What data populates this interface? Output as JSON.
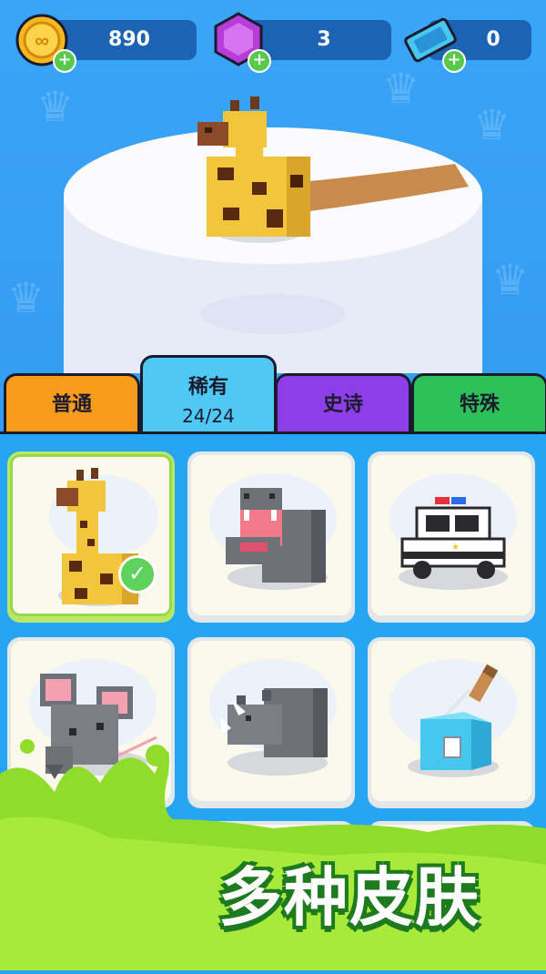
{
  "currency": {
    "coins": {
      "value": "890",
      "icon": "coin-icon"
    },
    "gems": {
      "value": "3",
      "icon": "gem-icon"
    },
    "tickets": {
      "value": "0",
      "icon": "ticket-icon"
    }
  },
  "tabs": [
    {
      "label": "普通",
      "color": "#f89a1c"
    },
    {
      "label": "稀有",
      "count": "24/24",
      "color": "#4fc8f6",
      "active": true
    },
    {
      "label": "史诗",
      "color": "#8d3ee8"
    },
    {
      "label": "特殊",
      "color": "#2ec15a"
    }
  ],
  "skins": [
    {
      "name": "giraffe",
      "selected": true
    },
    {
      "name": "hippo"
    },
    {
      "name": "police-car"
    },
    {
      "name": "mouse"
    },
    {
      "name": "rhino"
    },
    {
      "name": "ice-cube-pop"
    }
  ],
  "promo_text": "多种皮肤",
  "colors": {
    "accent_green": "#58c94a",
    "panel_blue": "#26a5f2",
    "bar_blue": "#1d63b4"
  }
}
